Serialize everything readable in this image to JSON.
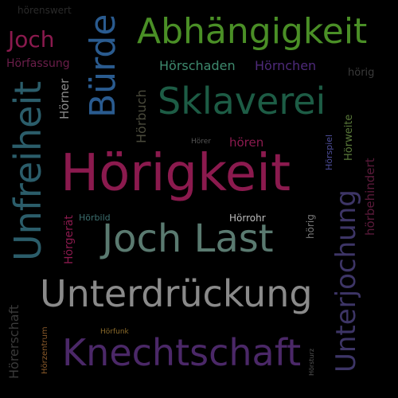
{
  "words": {
    "hoerigkeit": "Hörigkeit",
    "abhaengigkeit": "Abhängigkeit",
    "sklaverei": "Sklaverei",
    "unterdrueckung": "Unterdrückung",
    "knechtschaft": "Knechtschaft",
    "joch_last": "Joch Last",
    "joch": "Joch",
    "buerde": "Bürde",
    "unfreiheit": "Unfreiheit",
    "unterjochung": "Unterjochung",
    "hoerenswert": "hörenswert",
    "hoerfassung": "Hörfassung",
    "hoerschaden": "Hörschaden",
    "hoernchen": "Hörnchen",
    "hoerig": "hörig",
    "hoerner": "Hörner",
    "hoerbuch": "Hörbuch",
    "hoerer": "Hörer",
    "hoeren": "hören",
    "hoerspiel": "Hörspiel",
    "hoerweite": "Hörweite",
    "hoerbehindert": "hörbehindert",
    "hoerbild": "Hörbild",
    "hoergeraet": "Hörgerät",
    "hoerrohr": "Hörrohr",
    "hoerig2": "hörig",
    "hoerschaft": "Hörerschaft",
    "hoerzentrum": "Hörzentrum",
    "hoerfunk": "Hörfunk",
    "hoersturz": "Hörsturz"
  },
  "colors": {
    "hoerigkeit": "#8b1a4e",
    "abhaengigkeit": "#4a8f26",
    "sklaverei": "#1d5c45",
    "unterdrueckung": "#8a8a8a",
    "knechtschaft": "#4b2868",
    "joch_last": "#5a7a70",
    "joch": "#8b1a4e",
    "buerde": "#2a5b8f",
    "unfreiheit": "#2b5d6a",
    "unterjochung": "#3d3566"
  }
}
